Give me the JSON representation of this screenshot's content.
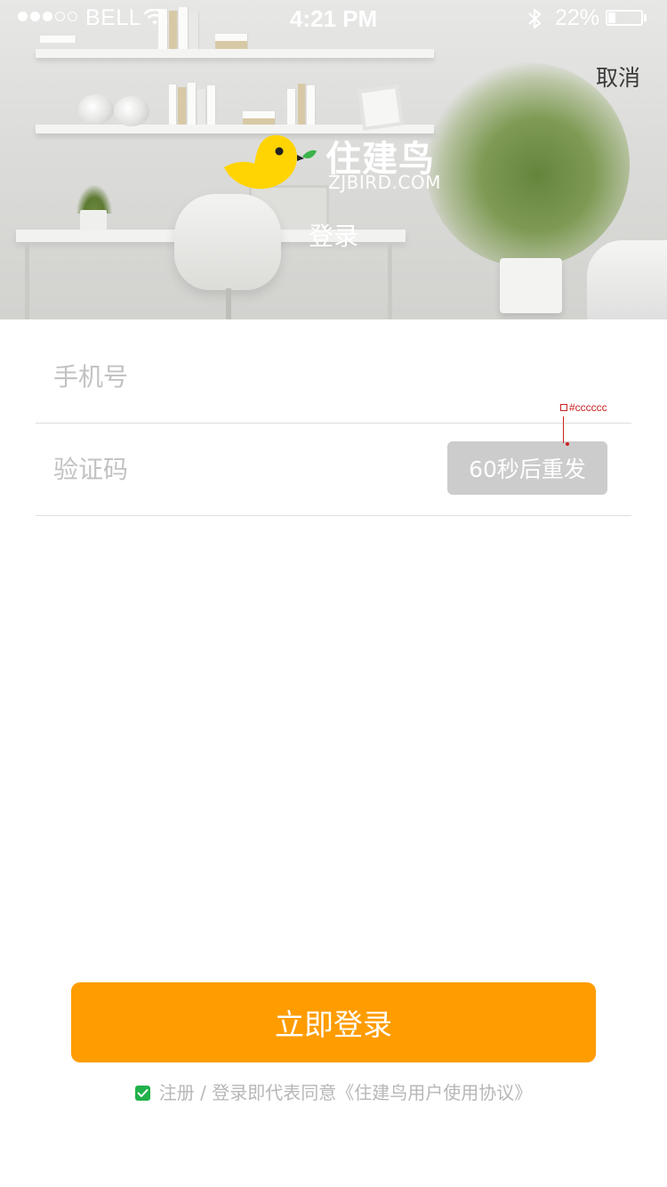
{
  "status_bar": {
    "carrier": "BELL",
    "time": "4:21 PM",
    "battery_percent": "22%",
    "battery_level": 0.22,
    "signal_bars_filled": 3,
    "signal_bars_total": 5
  },
  "header": {
    "cancel_label": "取消",
    "brand_name": "住建鸟",
    "brand_domain": "ZJBIRD.COM",
    "page_title": "登录"
  },
  "form": {
    "phone": {
      "placeholder": "手机号",
      "value": ""
    },
    "code": {
      "placeholder": "验证码",
      "value": ""
    },
    "resend_label": "60秒后重发"
  },
  "annotation": {
    "color_label": "#cccccc"
  },
  "footer": {
    "login_label": "立即登录",
    "agreement_text": "注册 / 登录即代表同意《住建鸟用户使用协议》",
    "agreement_checked": true
  },
  "colors": {
    "accent": "#ff9c00",
    "resend_bg": "#cccccc",
    "checkbox": "#21b14a",
    "logo_bird": "#ffd400"
  },
  "icons": [
    "wifi-icon",
    "bluetooth-icon",
    "battery-icon",
    "bird-logo-icon",
    "leaf-icon",
    "check-icon"
  ]
}
